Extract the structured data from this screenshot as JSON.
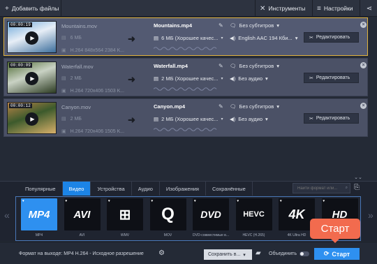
{
  "toolbar": {
    "add_files": "Добавить файлы",
    "tools": "Инструменты",
    "settings": "Настройки"
  },
  "files": [
    {
      "duration": "00:00:19",
      "src_name": "Mountains.mov",
      "src_size": "6 МБ",
      "src_info": "H.264 848x564 2384 K...",
      "out_name": "Mountains.mp4",
      "out_size": "6 МБ (Хорошее качес...",
      "subtitles": "Без субтитров",
      "audio": "English AAC 194 Кби...",
      "edit": "Редактировать",
      "selected": true,
      "thumb_colors": [
        "#6aa6d8",
        "#e7eef6",
        "#3c6e9c"
      ]
    },
    {
      "duration": "00:00:09",
      "src_name": "Waterfall.mov",
      "src_size": "2 МБ",
      "src_info": "H.264 720x406 1503 K...",
      "out_name": "Waterfall.mp4",
      "out_size": "2 МБ (Хорошее качес...",
      "subtitles": "Без субтитров",
      "audio": "Без аудио",
      "edit": "Редактировать",
      "selected": false,
      "thumb_colors": [
        "#4f6b34",
        "#c9d2c4",
        "#2c3b22"
      ]
    },
    {
      "duration": "00:00:12",
      "src_name": "Canyon.mov",
      "src_size": "2 МБ",
      "src_info": "H.264 720x406 1505 K...",
      "out_name": "Canyon.mp4",
      "out_size": "2 МБ (Хорошее качес...",
      "subtitles": "Без субтитров",
      "audio": "Без аудио",
      "edit": "Редактировать",
      "selected": false,
      "thumb_colors": [
        "#b98448",
        "#3c5a2c",
        "#d8b06a"
      ]
    }
  ],
  "tabs": [
    "Популярные",
    "Видео",
    "Устройства",
    "Аудио",
    "Изображения",
    "Сохранённые"
  ],
  "active_tab": "Видео",
  "search_placeholder": "Найти формат или...",
  "formats": [
    {
      "logo": "MP4",
      "label": "MP4",
      "selected": true
    },
    {
      "logo": "AVI",
      "label": "AVI",
      "selected": false
    },
    {
      "logo": "WMV",
      "label": "WMV",
      "selected": false
    },
    {
      "logo": "MOV",
      "label": "MOV",
      "selected": false
    },
    {
      "logo": "DVD",
      "label": "DVD-совместимые в...",
      "selected": false
    },
    {
      "logo": "HEVC",
      "label": "HEVC (H.265)",
      "selected": false
    },
    {
      "logo": "4K",
      "label": "4K Ultra HD",
      "selected": false
    },
    {
      "logo": "HD",
      "label": "",
      "selected": false
    }
  ],
  "bottom": {
    "output_format": "Формат на выходе: MP4 H.264 - Исходное разрешение",
    "save_to": "Сохранить в...",
    "merge": "Объединить",
    "start": "Старт"
  },
  "tooltip": "Старт",
  "colors": {
    "accent": "#2e90f0",
    "selected_border": "#e0b23e",
    "tooltip": "#f26b4e"
  }
}
